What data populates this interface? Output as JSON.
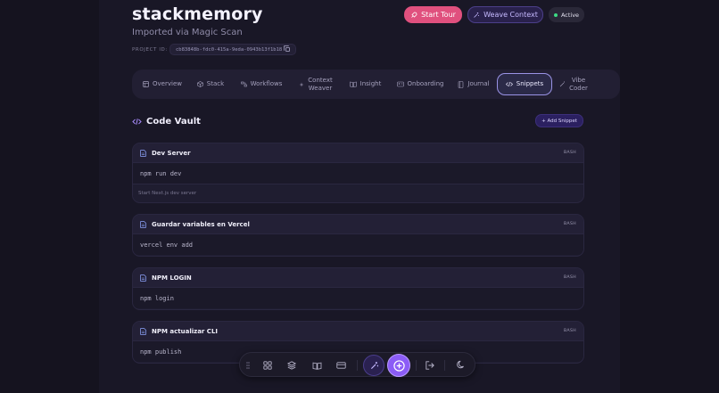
{
  "header": {
    "title": "stackmemory",
    "subtitle": "Imported via Magic Scan",
    "project_label": "PROJECT ID:",
    "project_id": "cb83848b-fdc0-415a-9eda-0943b13f1b18",
    "start_tour_label": "Start Tour",
    "weave_context_label": "Weave Context",
    "status_label": "Active"
  },
  "tabs": [
    {
      "label": "Overview",
      "icon": "grid-icon"
    },
    {
      "label": "Stack",
      "icon": "cube-icon"
    },
    {
      "label": "Workflows",
      "icon": "workflow-icon"
    },
    {
      "label": "Context Weaver",
      "icon": "sparkle-icon"
    },
    {
      "label": "Insight",
      "icon": "book-open-icon"
    },
    {
      "label": "Onboarding",
      "icon": "id-card-icon"
    },
    {
      "label": "Journal",
      "icon": "notebook-icon"
    },
    {
      "label": "Snippets",
      "icon": "code-icon",
      "active": true
    },
    {
      "label": "Vibe Coder",
      "icon": "wand-icon"
    }
  ],
  "vault": {
    "title": "Code Vault",
    "add_label": "+ Add Snippet"
  },
  "snippets": [
    {
      "title": "Dev Server",
      "lang": "BASH",
      "code": "npm run dev",
      "description": "Start Next.js dev server"
    },
    {
      "title": "Guardar variables en Vercel",
      "lang": "BASH",
      "code": "vercel env add"
    },
    {
      "title": "NPM LOGIN",
      "lang": "BASH",
      "code": "npm login"
    },
    {
      "title": "NPM actualizar CLI",
      "lang": "BASH",
      "code": "npm publish"
    }
  ],
  "colors": {
    "background": "#15131f",
    "accent_pink": "#e0507e",
    "accent_purple": "#8b5cf6",
    "status_green": "#3ddc84"
  }
}
